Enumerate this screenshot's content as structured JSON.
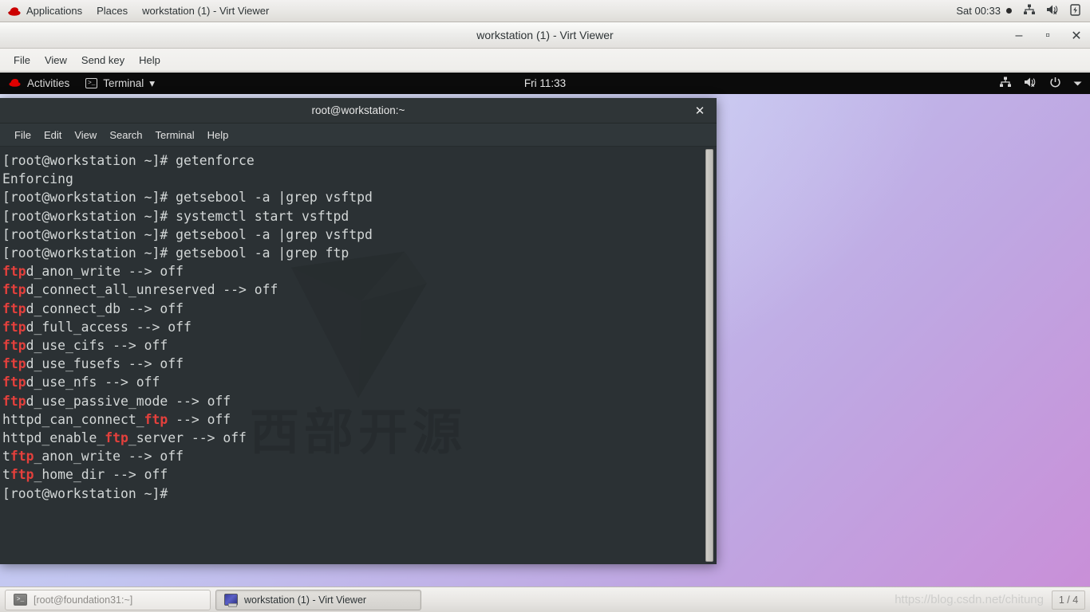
{
  "host_panel": {
    "logo_icon": "redhat-logo-icon",
    "applications_label": "Applications",
    "places_label": "Places",
    "window_title": "workstation (1) - Virt Viewer",
    "clock": "Sat 00:33",
    "icons": [
      "network-icon",
      "volume-muted-icon",
      "battery-icon"
    ]
  },
  "virt_viewer": {
    "title": "workstation (1) - Virt Viewer",
    "window_controls": {
      "minimize": "–",
      "maximize": "▫",
      "close": "✕"
    },
    "menu": [
      "File",
      "View",
      "Send key",
      "Help"
    ]
  },
  "guest_desktop": {
    "activities_label": "Activities",
    "app_menu_label": "Terminal",
    "app_menu_arrow": "▾",
    "clock": "Fri 11:33",
    "icons": [
      "network-icon",
      "volume-muted-icon",
      "power-icon",
      "chevron-down-icon"
    ]
  },
  "terminal": {
    "title": "root@workstation:~",
    "close_label": "✕",
    "menu": [
      "File",
      "Edit",
      "View",
      "Search",
      "Terminal",
      "Help"
    ],
    "watermark_text": "西部开源",
    "prompt": "[root@workstation ~]#",
    "highlight_color": "#e4403c",
    "foreground_color": "#d3d7d7",
    "background_color": "#2b3134",
    "lines": [
      {
        "type": "command",
        "prompt": "[root@workstation ~]# ",
        "text": "getenforce"
      },
      {
        "type": "output",
        "text": "Enforcing"
      },
      {
        "type": "command",
        "prompt": "[root@workstation ~]# ",
        "text": "getsebool -a |grep vsftpd"
      },
      {
        "type": "command",
        "prompt": "[root@workstation ~]# ",
        "text": "systemctl start vsftpd"
      },
      {
        "type": "command",
        "prompt": "[root@workstation ~]# ",
        "text": "getsebool -a |grep vsftpd"
      },
      {
        "type": "command",
        "prompt": "[root@workstation ~]# ",
        "text": "getsebool -a |grep ftp"
      },
      {
        "type": "match",
        "pre": "",
        "hl": "ftp",
        "post": "d_anon_write --> off"
      },
      {
        "type": "match",
        "pre": "",
        "hl": "ftp",
        "post": "d_connect_all_unreserved --> off"
      },
      {
        "type": "match",
        "pre": "",
        "hl": "ftp",
        "post": "d_connect_db --> off"
      },
      {
        "type": "match",
        "pre": "",
        "hl": "ftp",
        "post": "d_full_access --> off"
      },
      {
        "type": "match",
        "pre": "",
        "hl": "ftp",
        "post": "d_use_cifs --> off"
      },
      {
        "type": "match",
        "pre": "",
        "hl": "ftp",
        "post": "d_use_fusefs --> off"
      },
      {
        "type": "match",
        "pre": "",
        "hl": "ftp",
        "post": "d_use_nfs --> off"
      },
      {
        "type": "match",
        "pre": "",
        "hl": "ftp",
        "post": "d_use_passive_mode --> off"
      },
      {
        "type": "match",
        "pre": "httpd_can_connect_",
        "hl": "ftp",
        "post": " --> off"
      },
      {
        "type": "match",
        "pre": "httpd_enable_",
        "hl": "ftp",
        "post": "_server --> off"
      },
      {
        "type": "match",
        "pre": "t",
        "hl": "ftp",
        "post": "_anon_write --> off"
      },
      {
        "type": "match",
        "pre": "t",
        "hl": "ftp",
        "post": "_home_dir --> off"
      },
      {
        "type": "prompt_only",
        "prompt": "[root@workstation ~]# ",
        "text": ""
      }
    ]
  },
  "taskbar": {
    "items": [
      {
        "label": "[root@foundation31:~]",
        "icon": "terminal-icon",
        "active": false
      },
      {
        "label": "workstation (1) - Virt Viewer",
        "icon": "display-icon",
        "active": true
      }
    ],
    "watermark_url": "https://blog.csdn.net/chitung",
    "workspace": "1 / 4"
  }
}
